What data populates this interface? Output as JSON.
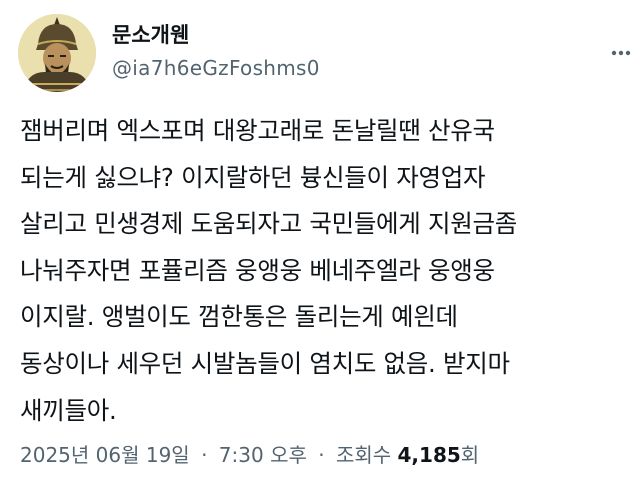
{
  "author": {
    "display_name": "문소개웬",
    "handle": "@ia7h6eGzFoshms0",
    "avatar_icon": "warrior-portrait-icon"
  },
  "more_icon": "more-options-icon",
  "tweet": {
    "lines": [
      "잼버리며 엑스포며 대왕고래로 돈날릴땐 산유국",
      "되는게 싫으냐? 이지랄하던 븅신들이 자영업자",
      "살리고 민생경제 도움되자고 국민들에게 지원금좀",
      "나눠주자면 포퓰리즘 웅앵웅 베네주엘라 웅앵웅",
      "이지랄. 앵벌이도 껌한통은 돌리는게 예읜데",
      "동상이나 세우던 시발놈들이 염치도 없음. 받지마",
      "새끼들아."
    ]
  },
  "meta": {
    "date": "2025년 06월 19일",
    "separator": "·",
    "time": "7:30 오후",
    "views_label": "조회수",
    "views_count": "4,185",
    "views_suffix": "회"
  },
  "colors": {
    "text_primary": "#0f1419",
    "text_secondary": "#536471",
    "avatar_bg": "#e7dfb0"
  }
}
